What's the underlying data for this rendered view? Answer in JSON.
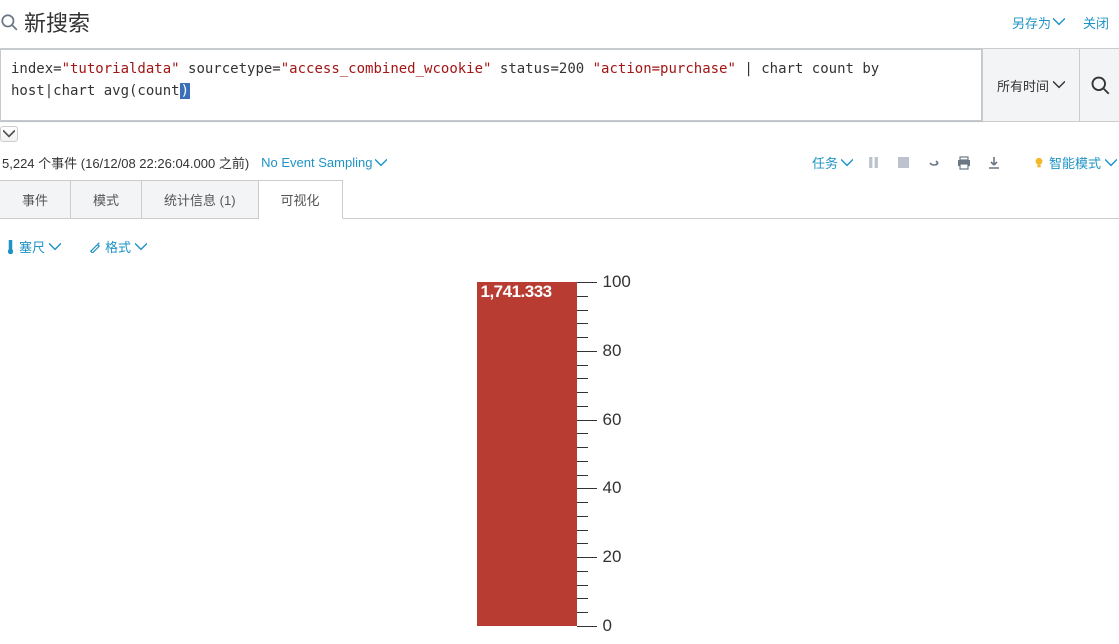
{
  "header": {
    "title": "新搜索",
    "save_as": "另存为",
    "close": "关闭"
  },
  "search": {
    "query_line1_prefix": "index=",
    "query_idx": "\"tutorialdata\"",
    "query_line1_mid": "  sourcetype=",
    "query_st": "\"access_combined_wcookie\"",
    "query_status": " status=200 ",
    "query_action": "\"action=purchase\"",
    "query_pipe1": " | chart count by",
    "query_line2_a": "host|chart avg(count",
    "query_line2_hl": ")",
    "time_label": "所有时间"
  },
  "status": {
    "events": "5,224 个事件 (16/12/08 22:26:04.000 之前)",
    "sampling": "No Event Sampling",
    "tasks": "任务",
    "smart": "智能模式"
  },
  "tabs": {
    "events": "事件",
    "patterns": "模式",
    "stats": "统计信息 (1)",
    "viz": "可视化"
  },
  "viz_tools": {
    "filler": "塞尺",
    "format": "格式"
  },
  "chart_data": {
    "type": "filler-gauge",
    "value": 1741.333,
    "value_label": "1,741.333",
    "scale_min": 0,
    "scale_max": 100,
    "major_ticks": [
      0,
      20,
      40,
      60,
      80,
      100
    ],
    "minor_step": 4,
    "fill_color": "#b83c32"
  }
}
